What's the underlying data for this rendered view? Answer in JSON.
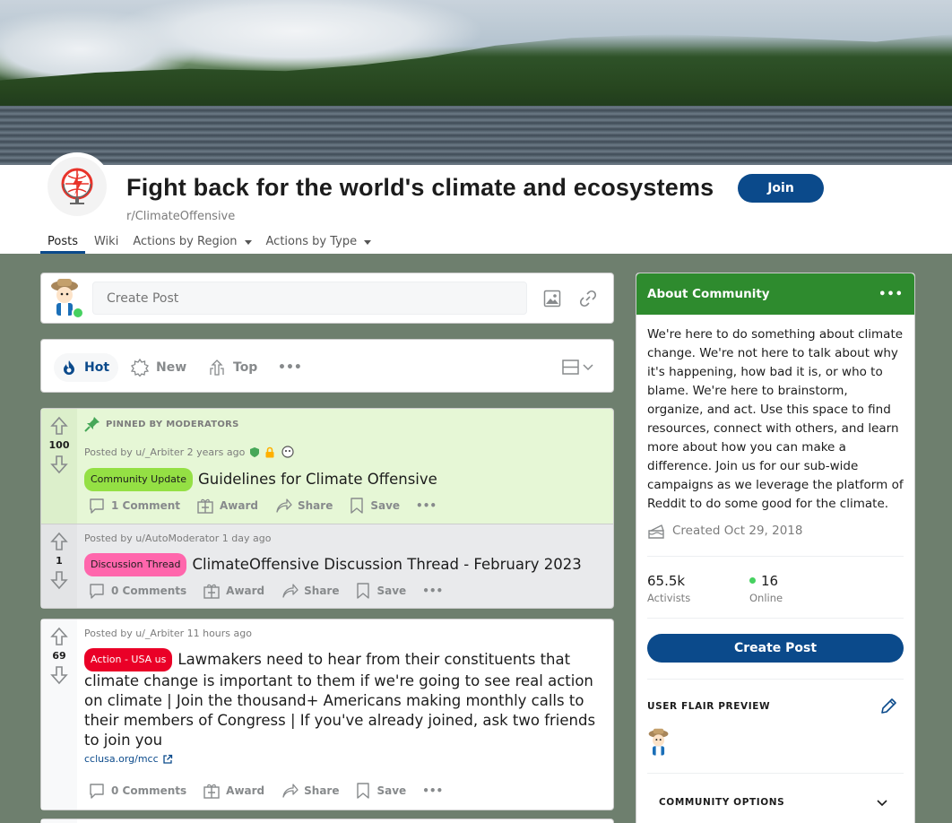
{
  "community": {
    "title": "Fight back for the world's climate and ecosystems",
    "name": "r/ClimateOffensive",
    "join_label": "Join"
  },
  "nav": {
    "tabs": [
      {
        "label": "Posts"
      },
      {
        "label": "Wiki"
      },
      {
        "label": "Actions by Region"
      },
      {
        "label": "Actions by Type"
      }
    ]
  },
  "create_post": {
    "placeholder": "Create Post"
  },
  "sort": {
    "hot": "Hot",
    "new": "New",
    "top": "Top"
  },
  "posts": [
    {
      "pinned_label": "PINNED BY MODERATORS",
      "score": "100",
      "meta": "Posted by u/_Arbiter 2 years ago",
      "flair": "Community Update",
      "title": "Guidelines for Climate Offensive",
      "comments": "1 Comment",
      "award": "Award",
      "share": "Share",
      "save": "Save"
    },
    {
      "score": "1",
      "meta": "Posted by u/AutoModerator 1 day ago",
      "flair": "Discussion Thread",
      "title": "ClimateOffensive Discussion Thread - February 2023",
      "comments": "0 Comments",
      "award": "Award",
      "share": "Share",
      "save": "Save"
    },
    {
      "score": "69",
      "meta": "Posted by u/_Arbiter 11 hours ago",
      "flair": "Action - USA us",
      "title": "Lawmakers need to hear from their constituents that climate change is important to them if we're going to see real action on climate | Join the thousand+ Americans making monthly calls to their members of Congress | If you've already joined, ask two friends to join you",
      "link": "cclusa.org/mcc",
      "comments": "0 Comments",
      "award": "Award",
      "share": "Share",
      "save": "Save"
    }
  ],
  "sidebar": {
    "heading": "About Community",
    "description": "We're here to do something about climate change. We're not here to talk about why it's happening, how bad it is, or who to blame. We're here to brainstorm, organize, and act. Use this space to find resources, connect with others, and learn more about how you can make a difference. Join us for our sub-wide campaigns as we leverage the platform of Reddit to do some good for the climate.",
    "created": "Created Oct 29, 2018",
    "members_count": "65.5k",
    "members_label": "Activists",
    "online_count": "16",
    "online_label": "Online",
    "create_post_label": "Create Post",
    "user_flair_heading": "USER FLAIR PREVIEW",
    "community_options": "COMMUNITY OPTIONS"
  },
  "colors": {
    "brand_blue": "#0b4a8b",
    "sidebar_header": "#2e8b2e",
    "page_bg": "#6e7f6e",
    "pinned_bg": "#e6f7d6"
  }
}
